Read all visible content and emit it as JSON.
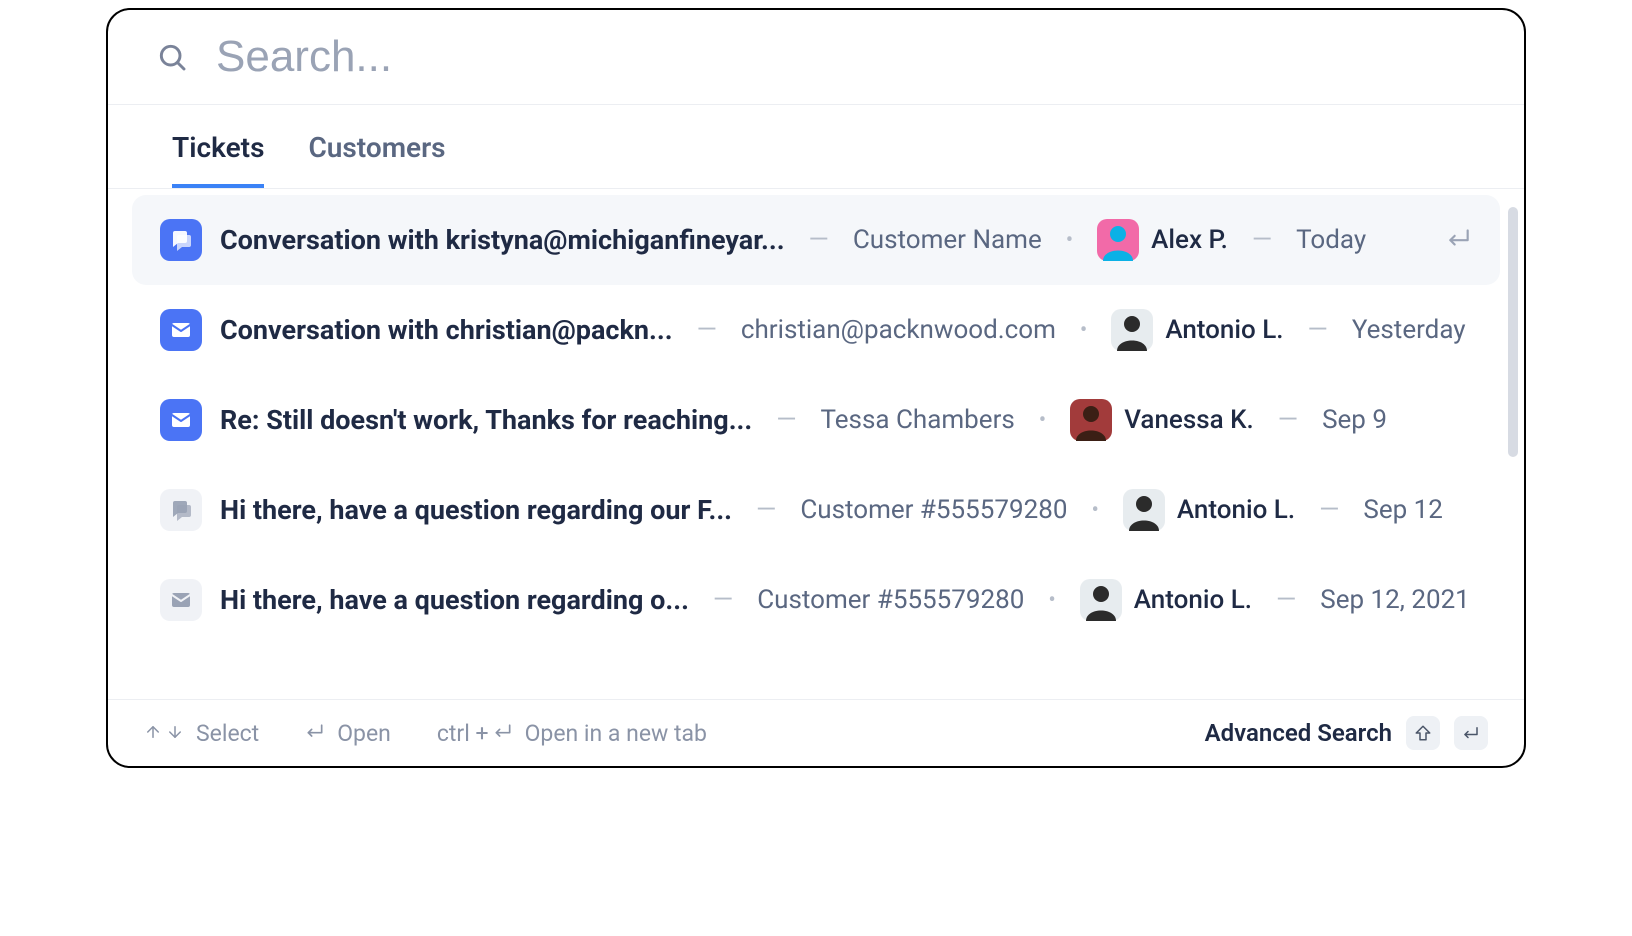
{
  "search": {
    "placeholder": "Search..."
  },
  "tabs": [
    {
      "label": "Tickets",
      "active": true
    },
    {
      "label": "Customers",
      "active": false
    }
  ],
  "results": [
    {
      "iconType": "chat",
      "iconState": "active",
      "title": "Conversation with kristyna@michiganfineyar...",
      "customer": "Customer Name",
      "assignee": "Alex P.",
      "avatarColor": {
        "bg": "#f26aa8",
        "fg": "#0bb1e6"
      },
      "date": "Today",
      "selected": true,
      "showEnter": true
    },
    {
      "iconType": "email",
      "iconState": "active",
      "title": "Conversation with christian@packn...",
      "customer": "christian@packnwood.com",
      "assignee": "Antonio L.",
      "avatarColor": {
        "bg": "#e7ecef",
        "fg": "#2b2b2b"
      },
      "date": "Yesterday",
      "selected": false,
      "showEnter": false
    },
    {
      "iconType": "email",
      "iconState": "active",
      "title": "Re: Still doesn't work, Thanks for reaching...",
      "customer": "Tessa Chambers",
      "assignee": "Vanessa K.",
      "avatarColor": {
        "bg": "#a23b3b",
        "fg": "#3b1f15"
      },
      "date": "Sep 9",
      "selected": false,
      "showEnter": false
    },
    {
      "iconType": "chat",
      "iconState": "muted",
      "title": "Hi there, have a question regarding our F...",
      "customer": "Customer #555579280",
      "assignee": "Antonio L.",
      "avatarColor": {
        "bg": "#e7ecef",
        "fg": "#2b2b2b"
      },
      "date": "Sep 12",
      "selected": false,
      "showEnter": false
    },
    {
      "iconType": "email",
      "iconState": "muted",
      "title": "Hi there, have a question regarding o...",
      "customer": "Customer #555579280",
      "assignee": "Antonio L.",
      "avatarColor": {
        "bg": "#e7ecef",
        "fg": "#2b2b2b"
      },
      "date": "Sep 12, 2021",
      "selected": false,
      "showEnter": false
    }
  ],
  "footer": {
    "select": "Select",
    "open": "Open",
    "newtab_prefix": "ctrl + ",
    "newtab": "Open in a new tab",
    "advanced": "Advanced Search"
  }
}
